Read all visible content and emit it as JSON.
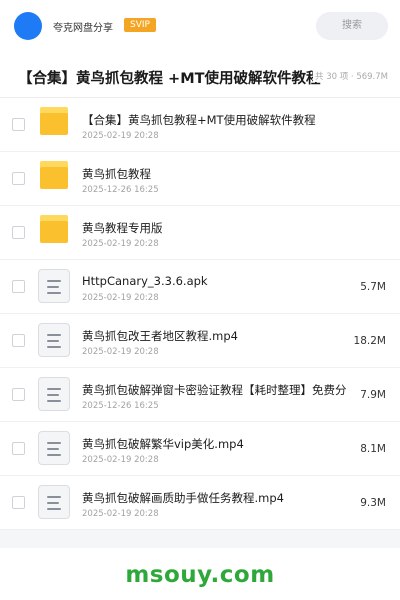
{
  "header": {
    "user_name": "夸克网盘分享",
    "vip_label": "SVIP",
    "search_placeholder": "搜索"
  },
  "folder": {
    "title": "【合集】黄鸟抓包教程 +MT使用破解软件教程",
    "meta": "共 30 项 · 569.7M"
  },
  "files": [
    {
      "name": "【合集】黄鸟抓包教程+MT使用破解软件教程",
      "date": "2025-02-19 20:28",
      "size": "",
      "type": "folder"
    },
    {
      "name": "黄鸟抓包教程",
      "date": "2025-12-26 16:25",
      "size": "",
      "type": "folder"
    },
    {
      "name": "黄鸟教程专用版",
      "date": "2025-02-19 20:28",
      "size": "",
      "type": "folder"
    },
    {
      "name": "HttpCanary_3.3.6.apk",
      "date": "2025-02-19 20:28",
      "size": "5.7M",
      "type": "file"
    },
    {
      "name": "黄鸟抓包改王者地区教程.mp4",
      "date": "2025-02-19 20:28",
      "size": "18.2M",
      "type": "file"
    },
    {
      "name": "黄鸟抓包破解弹窗卡密验证教程【耗时整理】免费分享：",
      "date": "2025-12-26 16:25",
      "size": "7.9M",
      "type": "file"
    },
    {
      "name": "黄鸟抓包破解繁华vip美化.mp4",
      "date": "2025-02-19 20:28",
      "size": "8.1M",
      "type": "file"
    },
    {
      "name": "黄鸟抓包破解画质助手做任务教程.mp4",
      "date": "2025-02-19 20:28",
      "size": "9.3M",
      "type": "file"
    }
  ],
  "watermark": "msouy.com",
  "colors": {
    "avatar": "#1e7bf5",
    "vip_badge": "#f5a524",
    "folder": "#fbc02d",
    "watermark": "#2fa83a"
  },
  "icons": {
    "folder": "folder-icon",
    "file": "document-icon"
  }
}
